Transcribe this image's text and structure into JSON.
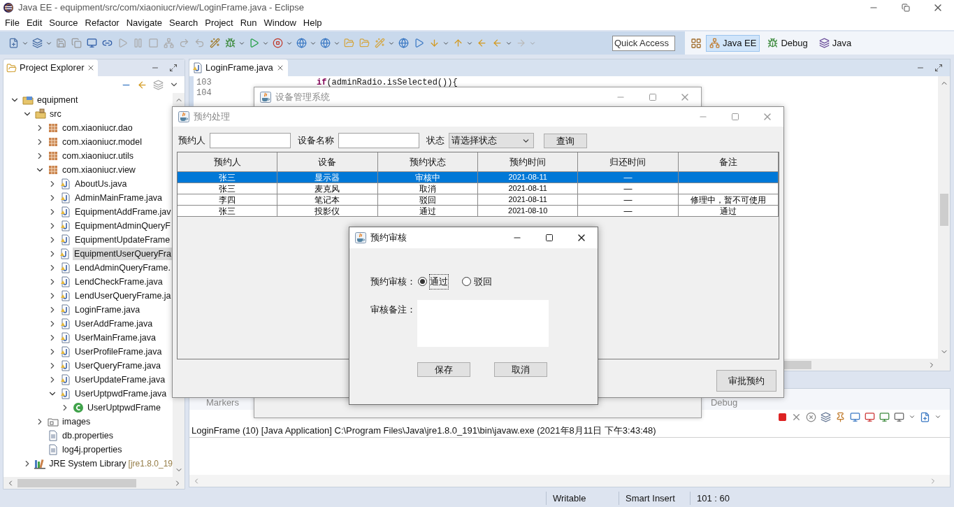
{
  "window": {
    "title": "Java EE - equipment/src/com/xiaoniucr/view/LoginFrame.java - Eclipse"
  },
  "menu": [
    "File",
    "Edit",
    "Source",
    "Refactor",
    "Navigate",
    "Search",
    "Project",
    "Run",
    "Window",
    "Help"
  ],
  "quick_access": {
    "placeholder": "Quick Access"
  },
  "perspectives": [
    {
      "label": "Java EE",
      "selected": true
    },
    {
      "label": "Debug",
      "selected": false
    },
    {
      "label": "Java",
      "selected": false
    }
  ],
  "project_explorer": {
    "title": "Project Explorer",
    "tree": [
      {
        "label": "equipment",
        "kind": "project",
        "expanded": true,
        "selected": false,
        "children": [
          {
            "label": "src",
            "kind": "source",
            "expanded": true,
            "selected": false,
            "children": [
              {
                "label": "com.xiaoniucr.dao",
                "kind": "package",
                "expanded": false,
                "selected": false
              },
              {
                "label": "com.xiaoniucr.model",
                "kind": "package",
                "expanded": false,
                "selected": false
              },
              {
                "label": "com.xiaoniucr.utils",
                "kind": "package",
                "expanded": false,
                "selected": false
              },
              {
                "label": "com.xiaoniucr.view",
                "kind": "package",
                "expanded": true,
                "selected": false,
                "children": [
                  {
                    "label": "AboutUs.java",
                    "kind": "java",
                    "expanded": false,
                    "selected": false
                  },
                  {
                    "label": "AdminMainFrame.java",
                    "kind": "java",
                    "expanded": false,
                    "selected": false
                  },
                  {
                    "label": "EquipmentAddFrame.jav",
                    "kind": "java",
                    "expanded": false,
                    "selected": false
                  },
                  {
                    "label": "EquipmentAdminQueryF",
                    "kind": "java",
                    "expanded": false,
                    "selected": false
                  },
                  {
                    "label": "EquipmentUpdateFrame",
                    "kind": "java",
                    "expanded": false,
                    "selected": false
                  },
                  {
                    "label": "EquipmentUserQueryFra",
                    "kind": "java",
                    "expanded": false,
                    "selected": true
                  },
                  {
                    "label": "LendAdminQueryFrame.",
                    "kind": "java",
                    "expanded": false,
                    "selected": false
                  },
                  {
                    "label": "LendCheckFrame.java",
                    "kind": "java",
                    "expanded": false,
                    "selected": false
                  },
                  {
                    "label": "LendUserQueryFrame.ja",
                    "kind": "java",
                    "expanded": false,
                    "selected": false
                  },
                  {
                    "label": "LoginFrame.java",
                    "kind": "java",
                    "expanded": false,
                    "selected": false
                  },
                  {
                    "label": "UserAddFrame.java",
                    "kind": "java",
                    "expanded": false,
                    "selected": false
                  },
                  {
                    "label": "UserMainFrame.java",
                    "kind": "java",
                    "expanded": false,
                    "selected": false
                  },
                  {
                    "label": "UserProfileFrame.java",
                    "kind": "java",
                    "expanded": false,
                    "selected": false
                  },
                  {
                    "label": "UserQueryFrame.java",
                    "kind": "java",
                    "expanded": false,
                    "selected": false
                  },
                  {
                    "label": "UserUpdateFrame.java",
                    "kind": "java",
                    "expanded": false,
                    "selected": false
                  },
                  {
                    "label": "UserUptpwdFrame.java",
                    "kind": "java",
                    "expanded": true,
                    "selected": false,
                    "children": [
                      {
                        "label": "UserUptpwdFrame",
                        "kind": "class",
                        "expanded": false,
                        "selected": false
                      }
                    ]
                  }
                ]
              },
              {
                "label": "images",
                "kind": "folder",
                "expanded": false,
                "selected": false
              },
              {
                "label": "db.properties",
                "kind": "properties",
                "selected": false
              },
              {
                "label": "log4j.properties",
                "kind": "properties",
                "selected": false
              }
            ]
          },
          {
            "label": "JRE System Library",
            "decoration": "[jre1.8.0_19",
            "kind": "library",
            "expanded": false,
            "selected": false
          }
        ]
      }
    ]
  },
  "editor": {
    "tab": "LoginFrame.java",
    "lines": [
      {
        "number": "103",
        "keyword": "if",
        "code": "(adminRadio.isSelected()){"
      },
      {
        "number": "104"
      }
    ]
  },
  "bottom_panel": {
    "tabs": [
      "Markers",
      "Debug"
    ],
    "console_title": "LoginFrame (10) [Java Application] C:\\Program Files\\Java\\jre1.8.0_191\\bin\\javaw.exe (2021年8月11日 下午3:43:48)"
  },
  "status_bar": [
    "Writable",
    "Smart Insert",
    "101 : 60"
  ],
  "main_window": {
    "title": "设备管理系统",
    "active": false
  },
  "booking_window": {
    "title": "预约处理",
    "active": false,
    "filters": [
      {
        "label": "预约人",
        "kind": "text"
      },
      {
        "label": "设备名称",
        "kind": "text"
      },
      {
        "label": "状态",
        "kind": "select",
        "value": "请选择状态"
      }
    ],
    "search_button": "查询",
    "columns": [
      "预约人",
      "设备",
      "预约状态",
      "预约时间",
      "归还时间",
      "备注"
    ],
    "rows": [
      {
        "person": "张三",
        "equipment": "显示器",
        "status": "审核中",
        "time": "2021-08-11",
        "return_time": "—",
        "selected": true
      },
      {
        "person": "张三",
        "equipment": "麦克风",
        "status": "取消",
        "time": "2021-08-11",
        "return_time": "—",
        "selected": false
      },
      {
        "person": "李四",
        "equipment": "笔记本",
        "status": "驳回",
        "time": "2021-08-11",
        "return_time": "—",
        "note": "修理中，暂不可使用",
        "selected": false
      },
      {
        "person": "张三",
        "equipment": "投影仪",
        "status": "通过",
        "time": "2021-08-10",
        "return_time": "—",
        "note": "通过",
        "selected": false
      }
    ],
    "approve_button": "审批预约"
  },
  "review_dialog": {
    "title": "预约审核",
    "active": true,
    "review_label": "预约审核：",
    "options": [
      {
        "label": "通过",
        "selected": true
      },
      {
        "label": "驳回",
        "selected": false
      }
    ],
    "note_label": "审核备注：",
    "buttons": [
      "保存",
      "取消"
    ]
  }
}
